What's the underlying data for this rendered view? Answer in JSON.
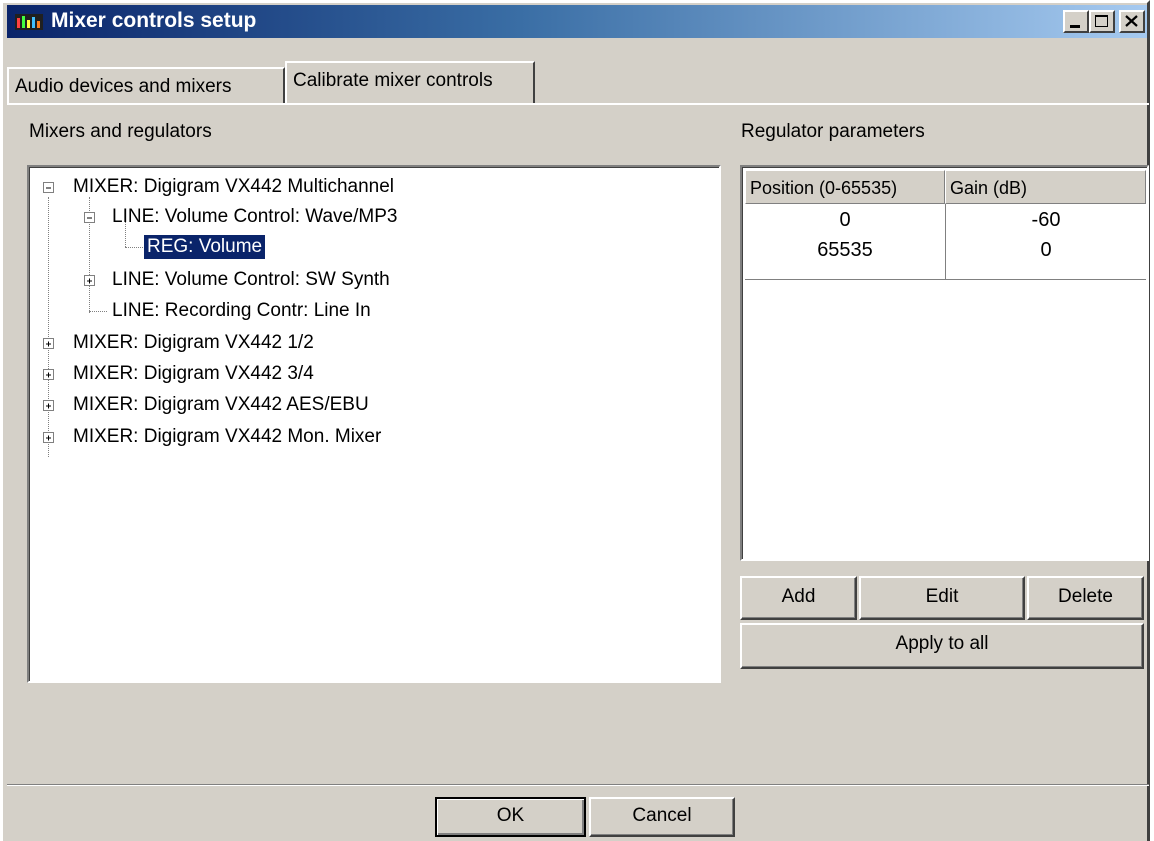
{
  "window": {
    "title": "Mixer controls setup",
    "title_buttons": [
      "minimize-icon",
      "maximize-icon",
      "close-icon"
    ]
  },
  "tabs": [
    {
      "label": "Audio devices and mixers",
      "active": false
    },
    {
      "label": "Calibrate mixer controls",
      "active": true
    }
  ],
  "left_panel": {
    "label": "Mixers and regulators",
    "tree": [
      {
        "label": "MIXER: Digigram VX442 Multichannel",
        "expander": "minus"
      },
      {
        "label": "LINE: Volume Control: Wave/MP3",
        "expander": "minus"
      },
      {
        "label": "REG: Volume",
        "expander": "",
        "selected": true
      },
      {
        "label": "LINE: Volume Control: SW Synth",
        "expander": "plus"
      },
      {
        "label": "LINE: Recording Contr: Line In",
        "expander": ""
      },
      {
        "label": "MIXER: Digigram VX442 1/2",
        "expander": "plus"
      },
      {
        "label": "MIXER: Digigram VX442 3/4",
        "expander": "plus"
      },
      {
        "label": "MIXER: Digigram VX442 AES/EBU",
        "expander": "plus"
      },
      {
        "label": "MIXER: Digigram VX442 Mon. Mixer",
        "expander": "plus"
      }
    ]
  },
  "right_panel": {
    "label": "Regulator parameters",
    "columns": [
      "Position (0-65535)",
      "Gain (dB)"
    ],
    "rows": [
      [
        "0",
        "-60"
      ],
      [
        "65535",
        "0"
      ]
    ],
    "buttons": {
      "add": "Add",
      "edit": "Edit",
      "delete": "Delete",
      "apply_all": "Apply to all"
    }
  },
  "footer": {
    "ok": "OK",
    "cancel": "Cancel"
  }
}
